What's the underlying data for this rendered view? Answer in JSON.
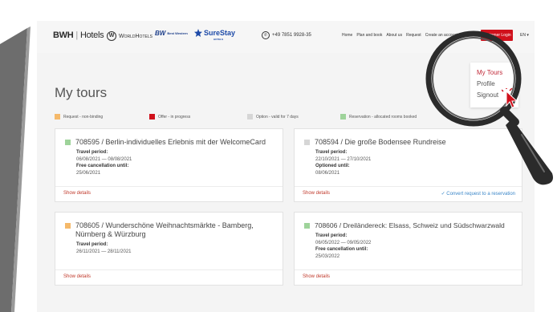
{
  "header": {
    "logo_bwh": "BWH",
    "logo_hotels": "Hotels",
    "logo_worldhotels": "WorldHotels",
    "logo_bestwestern": "BW",
    "logo_bestwestern_text": "Best Western",
    "logo_surestay": "SureStay",
    "logo_surestay_sub": "HOTELS",
    "phone": "+49 7851 9928-35",
    "menu": [
      "Home",
      "Plan and book",
      "About us",
      "Request",
      "Create an account"
    ],
    "login_button": "Customer Login",
    "language": "EN ▾"
  },
  "dropdown": {
    "items": [
      "My Tours",
      "Profile",
      "Signout"
    ]
  },
  "page_title": "My tours",
  "legend": [
    {
      "label": "Request - non-binding",
      "color": "#f5b96a"
    },
    {
      "label": "Offer - in progress",
      "color": "#d0111c"
    },
    {
      "label": "Option - valid for 7 days",
      "color": "#d6d6d6"
    },
    {
      "label": "Reservation - allocated rooms booked",
      "color": "#9ed39a"
    }
  ],
  "tours": [
    {
      "title": "708595  /  Berlin-individuelles Erlebnis mit der WelcomeCard",
      "status_color": "#9ed39a",
      "lines": [
        {
          "label": "Travel period:",
          "value": "06/08/2021 — 08/08/2021"
        },
        {
          "label": "Free cancellation until:",
          "value": "25/06/2021"
        }
      ],
      "show_details": "Show details",
      "convert": ""
    },
    {
      "title": "708594  /  Die große Bodensee Rundreise",
      "status_color": "#d6d6d6",
      "lines": [
        {
          "label": "Travel period:",
          "value": "22/10/2021 — 27/10/2021"
        },
        {
          "label": "Optioned until:",
          "value": "08/06/2021"
        }
      ],
      "show_details": "Show details",
      "convert": "✓ Convert request to a reservation"
    },
    {
      "title": "708605  /  Wunderschöne Weihnachtsmärkte - Bamberg, Nürnberg & Würzburg",
      "status_color": "#f5b96a",
      "lines": [
        {
          "label": "Travel period:",
          "value": "26/11/2021 — 28/11/2021"
        }
      ],
      "show_details": "Show details",
      "convert": ""
    },
    {
      "title": "708606  /  Dreiländereck: Elsass, Schweiz und Südschwarzwald",
      "status_color": "#9ed39a",
      "lines": [
        {
          "label": "Travel period:",
          "value": "06/05/2022 — 09/05/2022"
        },
        {
          "label": "Free cancellation until:",
          "value": "25/03/2022"
        }
      ],
      "show_details": "Show details",
      "convert": ""
    }
  ],
  "icons": {
    "phone": "phone-icon",
    "magnifier": "magnifying-glass-icon",
    "cursor": "mouse-pointer-icon",
    "check": "check-icon"
  },
  "colors": {
    "brand_red": "#d0111c",
    "link_red": "#c0392b",
    "link_blue": "#3a86c8"
  }
}
